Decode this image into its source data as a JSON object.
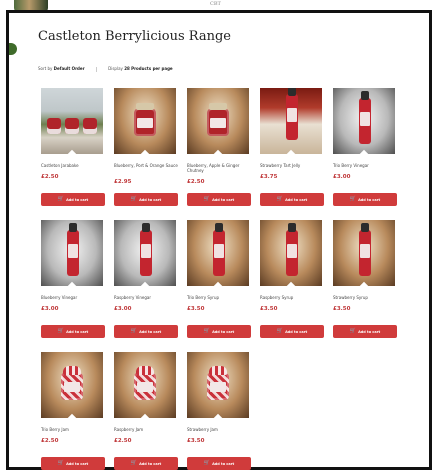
{
  "header": {
    "logo_text": "CBT"
  },
  "page": {
    "title": "Castleton Berrylicious Range"
  },
  "toolbar": {
    "sort_prefix": "Sort by",
    "sort_value": "Default Order",
    "display_prefix": "Display",
    "display_value": "28 Products per page"
  },
  "colors": {
    "accent": "#d03b3b",
    "price": "#c0393b"
  },
  "add_to_cart_label": "Add to cart",
  "products": [
    {
      "name": "Castleton Jarabake",
      "price": "£2.50",
      "image": "grass"
    },
    {
      "name": "Blueberry, Port & Orange Sauce",
      "price": "£2.95",
      "image": "jar"
    },
    {
      "name": "Blueberry, Apple & Ginger Chutney",
      "price": "£2.50",
      "image": "jar"
    },
    {
      "name": "Strawberry Tart Jelly",
      "price": "£3.75",
      "image": "table"
    },
    {
      "name": "Trio Berry Vinegar",
      "price": "£3.00",
      "image": "bottle"
    },
    {
      "name": "Blueberry Vinegar",
      "price": "£3.00",
      "image": "bottle"
    },
    {
      "name": "Raspberry Vinegar",
      "price": "£3.00",
      "image": "bottle"
    },
    {
      "name": "Trio Berry Syrup",
      "price": "£3.50",
      "image": "bottle"
    },
    {
      "name": "Raspberry Syrup",
      "price": "£3.50",
      "image": "bottle"
    },
    {
      "name": "Strawberry Syrup",
      "price": "£3.50",
      "image": "bottle"
    },
    {
      "name": "Trio Berry Jam",
      "price": "£2.50",
      "image": "gingham"
    },
    {
      "name": "Raspberry Jam",
      "price": "£2.50",
      "image": "gingham"
    },
    {
      "name": "Strawberry Jam",
      "price": "£3.50",
      "image": "gingham"
    }
  ]
}
